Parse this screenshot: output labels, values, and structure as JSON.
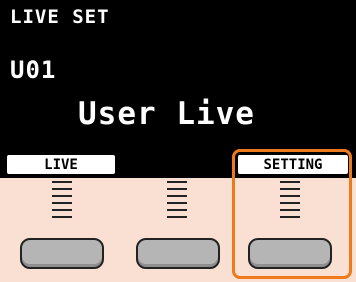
{
  "display": {
    "header": "LIVE SET",
    "number": "U01",
    "name": "User Live"
  },
  "softkeys": {
    "left_label": "LIVE",
    "middle_label": "",
    "right_label": "SETTING"
  },
  "colors": {
    "screen_background": "#000000",
    "panel_background": "#f9e0d2",
    "highlight": "#ee7a1c",
    "button_fill": "#b5b5b5"
  }
}
